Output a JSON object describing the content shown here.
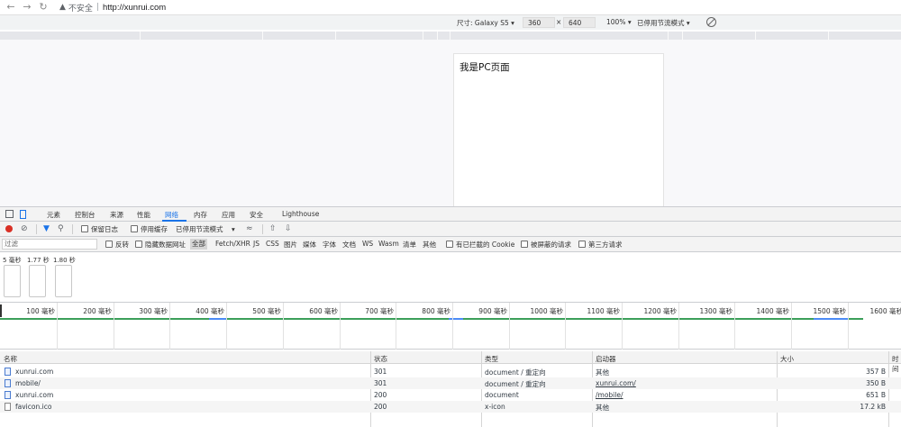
{
  "browser": {
    "back_icon": "arrow-left-icon",
    "forward_icon": "arrow-right-icon",
    "reload_icon": "reload-icon",
    "insecure_label": "不安全",
    "url": "http://xunrui.com"
  },
  "device_toolbar": {
    "size_label": "尺寸: Galaxy S5",
    "width": "360",
    "times": "×",
    "height": "640",
    "zoom": "100%",
    "throttle": "已停用节流模式",
    "rotate_icon": "rotate-icon"
  },
  "page": {
    "text": "我是PC页面"
  },
  "devtools": {
    "tabs": [
      "元素",
      "控制台",
      "来源",
      "性能",
      "网络",
      "内存",
      "应用",
      "安全",
      "Lighthouse"
    ],
    "active_tab": "网络"
  },
  "network_toolbar": {
    "preserve_log": "保留日志",
    "disable_cache": "停用缓存",
    "throttle": "已停用节流模式"
  },
  "filter": {
    "placeholder": "过滤",
    "invert": "反转",
    "hide_data_urls": "隐藏数据网址",
    "types": [
      "全部",
      "Fetch/XHR",
      "JS",
      "CSS",
      "图片",
      "媒体",
      "字体",
      "文档",
      "WS",
      "Wasm",
      "清单",
      "其他"
    ],
    "blocked_cookies": "有已拦截的 Cookie",
    "blocked_requests": "被屏蔽的请求",
    "third_party": "第三方请求"
  },
  "overview": {
    "times": [
      "5 毫秒",
      "1.77 秒",
      "1.80 秒"
    ]
  },
  "timeline": {
    "ticks": [
      "100 毫秒",
      "200 毫秒",
      "300 毫秒",
      "400 毫秒",
      "500 毫秒",
      "600 毫秒",
      "700 毫秒",
      "800 毫秒",
      "900 毫秒",
      "1000 毫秒",
      "1100 毫秒",
      "1200 毫秒",
      "1300 毫秒",
      "1400 毫秒",
      "1500 毫秒",
      "1600 毫秒"
    ]
  },
  "table": {
    "headers": {
      "name": "名称",
      "status": "状态",
      "type": "类型",
      "initiator": "启动器",
      "size": "大小",
      "time": "时间"
    },
    "rows": [
      {
        "name": "xunrui.com",
        "status": "301",
        "type": "document / 重定向",
        "initiator": "其他",
        "size": "357 B"
      },
      {
        "name": "mobile/",
        "status": "301",
        "type": "document / 重定向",
        "initiator": "xunrui.com/",
        "size": "350 B"
      },
      {
        "name": "xunrui.com",
        "status": "200",
        "type": "document",
        "initiator": "/mobile/",
        "size": "651 B"
      },
      {
        "name": "favicon.ico",
        "status": "200",
        "type": "x-icon",
        "initiator": "其他",
        "size": "17.2 kB"
      }
    ]
  }
}
